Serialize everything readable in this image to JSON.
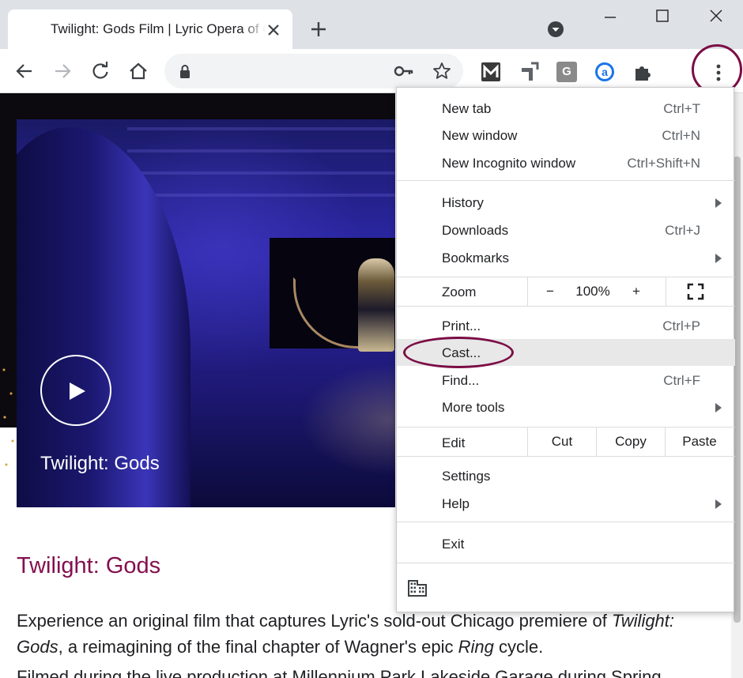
{
  "browser": {
    "tab_title": "Twilight: Gods Film | Lyric Opera of Chicago",
    "url": ""
  },
  "video": {
    "title": "Twilight: Gods"
  },
  "page": {
    "heading": "Twilight: Gods",
    "para1_a": "Experience an original film that captures Lyric's sold-out Chicago premiere of ",
    "para1_em1": "Twilight: Gods",
    "para1_b": ", a reimagining of the final chapter of Wagner's epic ",
    "para1_em2": "Ring",
    "para1_c": " cycle.",
    "para2": "Filmed during the live production at Millennium Park Lakeside Garage during Spring"
  },
  "menu": {
    "new_tab": "New tab",
    "new_tab_sc": "Ctrl+T",
    "new_window": "New window",
    "new_window_sc": "Ctrl+N",
    "new_incognito": "New Incognito window",
    "new_incognito_sc": "Ctrl+Shift+N",
    "history": "History",
    "downloads": "Downloads",
    "downloads_sc": "Ctrl+J",
    "bookmarks": "Bookmarks",
    "zoom": "Zoom",
    "zoom_minus": "−",
    "zoom_level": "100%",
    "zoom_plus": "+",
    "print": "Print...",
    "print_sc": "Ctrl+P",
    "cast": "Cast...",
    "find": "Find...",
    "find_sc": "Ctrl+F",
    "more_tools": "More tools",
    "edit": "Edit",
    "cut": "Cut",
    "copy": "Copy",
    "paste": "Paste",
    "settings": "Settings",
    "help": "Help",
    "exit": "Exit"
  },
  "colors": {
    "accent": "#84104e",
    "highlight_ring": "#7b0d45"
  }
}
